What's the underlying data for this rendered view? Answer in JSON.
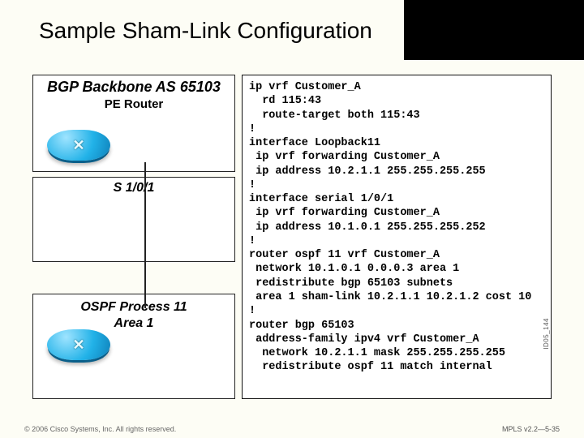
{
  "slide": {
    "title": "Sample Sham-Link Configuration"
  },
  "diagram": {
    "bgp_as_label": "BGP Backbone AS 65103",
    "pe_label": "PE Router",
    "serial_label": "S 1/0/1",
    "ospf_label_line1": "OSPF Process 11",
    "ospf_label_line2": "Area 1"
  },
  "config_text": "ip vrf Customer_A\n  rd 115:43\n  route-target both 115:43\n!\ninterface Loopback11\n ip vrf forwarding Customer_A\n ip address 10.2.1.1 255.255.255.255\n!\ninterface serial 1/0/1\n ip vrf forwarding Customer_A\n ip address 10.1.0.1 255.255.255.252\n!\nrouter ospf 11 vrf Customer_A\n network 10.1.0.1 0.0.0.3 area 1\n redistribute bgp 65103 subnets\n area 1 sham-link 10.2.1.1 10.2.1.2 cost 10\n!\nrouter bgp 65103\n address-family ipv4 vrf Customer_A\n  network 10.2.1.1 mask 255.255.255.255\n  redistribute ospf 11 match internal",
  "footer": {
    "copyright": "© 2006 Cisco Systems, Inc. All rights reserved.",
    "page_code": "MPLS v2.2—5-35"
  },
  "meta": {
    "side_code": "ID05_144"
  }
}
